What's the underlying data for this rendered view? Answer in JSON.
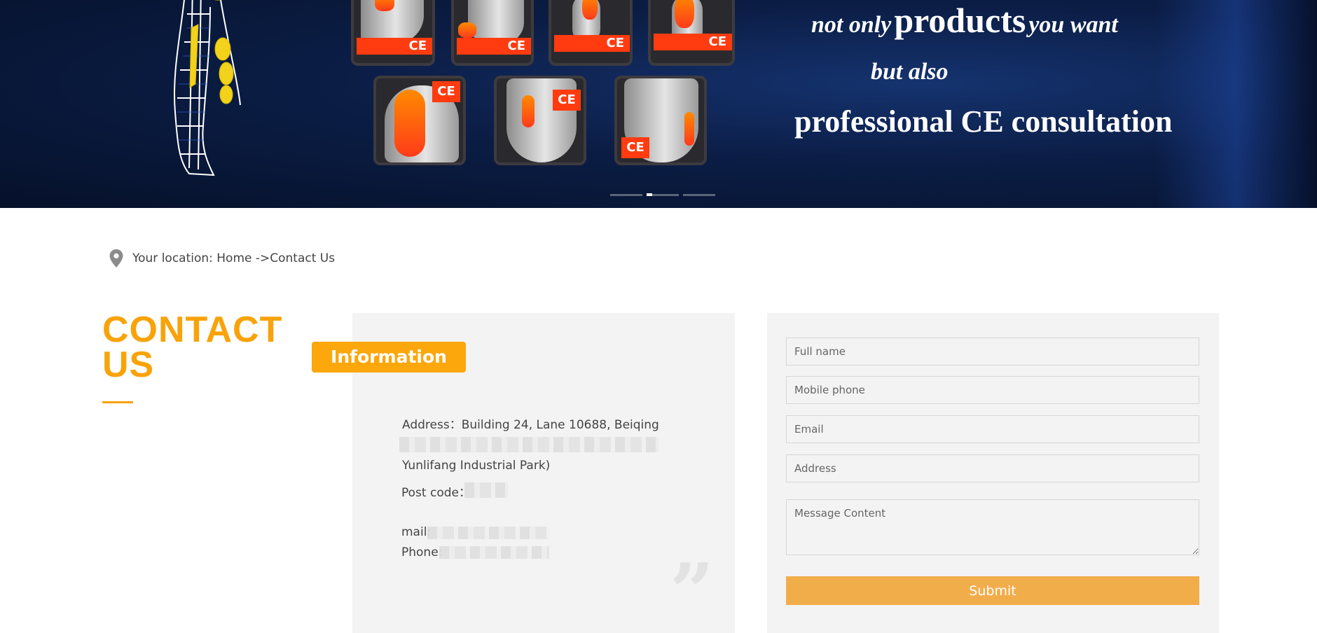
{
  "banner": {
    "slogan": {
      "line1_pre": "not only",
      "line1_big": "products",
      "line1_post": "you want",
      "line2": "but also",
      "line3": "professional CE consultation"
    },
    "ce_mark": "CE",
    "carousel": {
      "slides": 3,
      "active": 2
    }
  },
  "breadcrumb": {
    "text": "Your location: Home ->Contact Us"
  },
  "contact": {
    "title_line1": "CONTACT",
    "title_line2": "US"
  },
  "info": {
    "tag": "Information",
    "address_line1": "Address：Building 24, Lane 10688, Beiqing",
    "address_line3": "Yunlifang Industrial Park)",
    "postcode_label": "Post code：",
    "mail_label": "mail:",
    "phone_label": "Phone:"
  },
  "form": {
    "full_name_placeholder": "Full name",
    "mobile_placeholder": "Mobile phone",
    "email_placeholder": "Email",
    "address_placeholder": "Address",
    "message_placeholder": "Message Content",
    "submit_label": "Submit"
  },
  "colors": {
    "accent": "#f8a30a",
    "submit": "#f2ad4b",
    "banner_bg": "#0b1d45",
    "ce_red": "#ff3b0f"
  }
}
